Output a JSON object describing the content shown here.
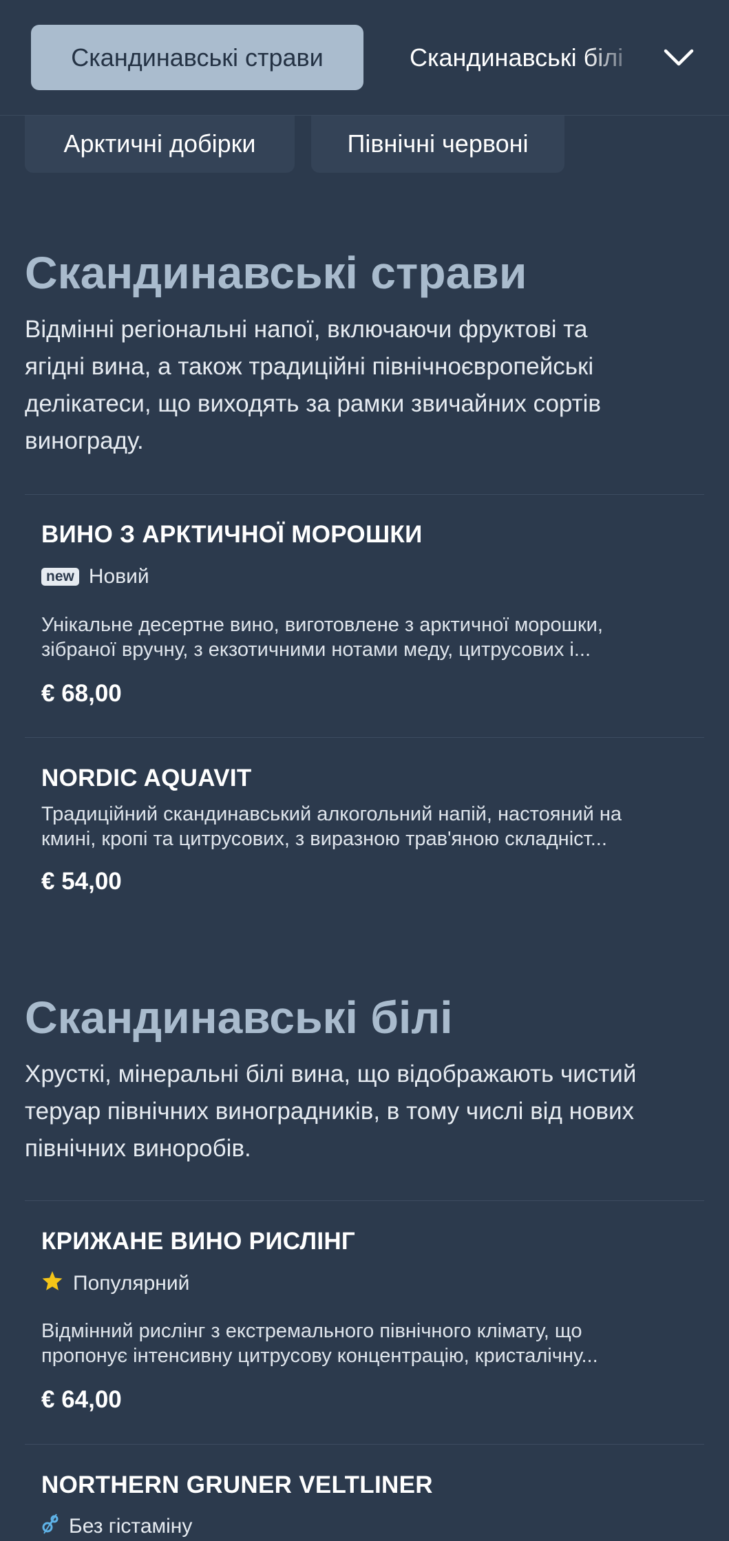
{
  "category_tabs": {
    "active": "Скандинавські страви",
    "next": "Скандинавські білі",
    "more": [
      "Арктичні добірки",
      "Північні червоні"
    ]
  },
  "sections": [
    {
      "title": "Скандинавські страви",
      "description_lines": [
        "Відмінні регіональні напої, включаючи фруктові та",
        "ягідні вина, а також традиційні північноєвропейські",
        "делікатеси, що виходять за рамки звичайних сортів",
        "винограду."
      ],
      "items": [
        {
          "name": "ВИНО З АРКТИЧНОЇ МОРОШКИ",
          "badge_tag": "new",
          "badge_label": "Новий",
          "description_lines": [
            "Унікальне десертне вино, виготовлене з арктичної морошки,",
            "зібраної вручну, з екзотичними нотами меду, цитрусових і..."
          ],
          "price": "€ 68,00"
        },
        {
          "name": "NORDIC AQUAVIT",
          "description_lines": [
            "Традиційний скандинавський алкогольний напій, настояний на",
            "кмині, кропі та цитрусових, з виразною трав'яною складніст..."
          ],
          "price": "€ 54,00"
        }
      ]
    },
    {
      "title": "Скандинавські білі",
      "description_lines": [
        "Хрусткі, мінеральні білі вина, що відображають чистий",
        "теруар північних виноградників, в тому числі від нових",
        "північних виноробів."
      ],
      "items": [
        {
          "name": "КРИЖАНЕ ВИНО РИСЛІНГ",
          "badge_icon": "star-icon",
          "badge_label": "Популярний",
          "description_lines": [
            "Відмінний рислінг з екстремального північного клімату, що",
            "пропонує інтенсивну цитрусову концентрацію, кристалічну..."
          ],
          "price": "€ 64,00"
        },
        {
          "name": "NORTHERN GRUNER VELTLINER",
          "badge_icon": "histamine-free-icon",
          "badge_label": "Без гістаміну"
        }
      ]
    }
  ],
  "colors": {
    "background": "#2c3a4d",
    "active_tab": "#aabcce",
    "section_title": "#a9bbcd",
    "star": "#f5c518",
    "histamine_icon": "#5fb3e8"
  }
}
